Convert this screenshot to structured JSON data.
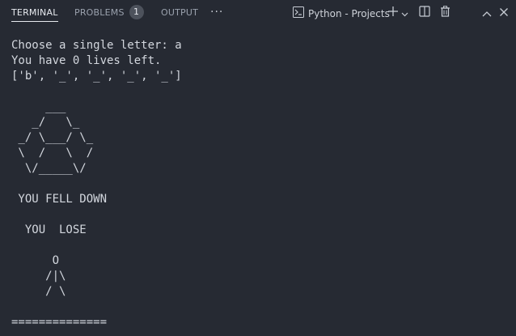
{
  "tabs": [
    {
      "label": "TERMINAL",
      "active": true
    },
    {
      "label": "PROBLEMS",
      "badge": "1"
    },
    {
      "label": "OUTPUT"
    }
  ],
  "toolbar": {
    "more_icon": "ellipsis-icon",
    "terminal_label": "Python - Projects",
    "icons": [
      "terminal-icon",
      "plus-icon",
      "chevron-down-icon",
      "split-icon",
      "trash-icon",
      "chevron-up-icon",
      "close-icon"
    ]
  },
  "terminal_lines": [
    "Choose a single letter: a",
    "You have 0 lives left.",
    "['b', '_', '_', '_', '_']",
    "",
    "     ___",
    "   _/   \\_",
    " _/ \\___/ \\_",
    " \\  /   \\  /",
    "  \\/_____\\/",
    "",
    " YOU FELL DOWN",
    "",
    "  YOU  LOSE",
    "",
    "      O",
    "     /|\\",
    "     / \\",
    "",
    "=============="
  ],
  "colors": {
    "background": "#262a33",
    "text": "#d3d7de",
    "tab_inactive": "#9aa1ad"
  }
}
